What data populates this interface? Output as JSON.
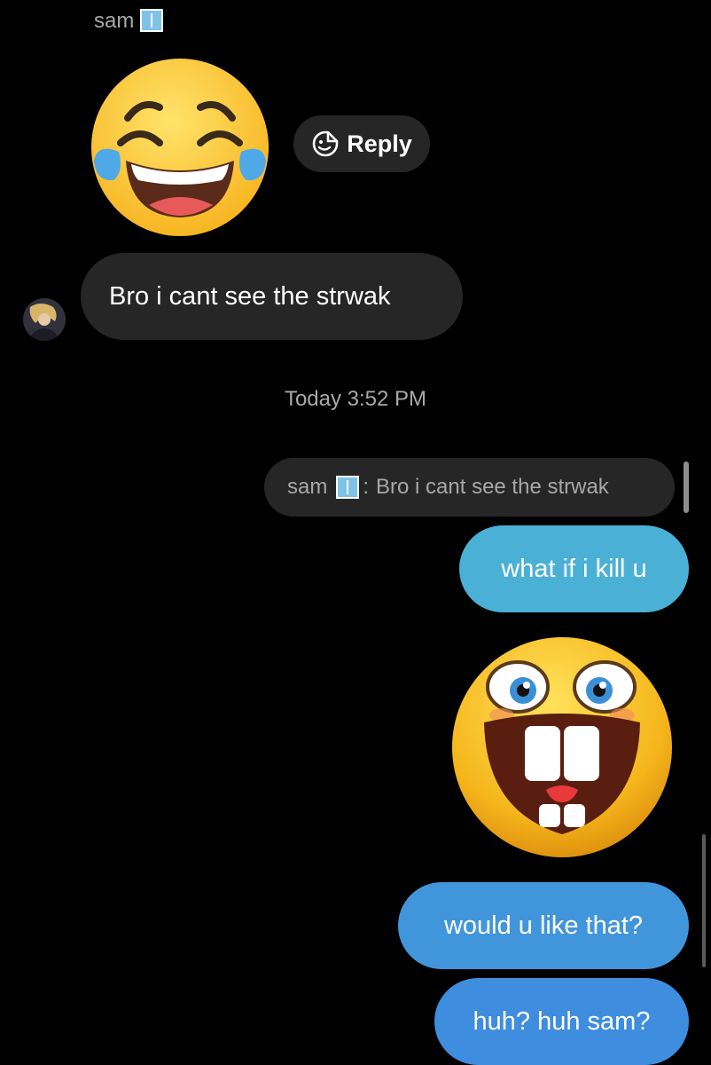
{
  "chat": {
    "sender_name": "sam",
    "reply_label": "Reply",
    "incoming_message": "Bro i cant see the strwak",
    "timestamp": "Today 3:52 PM",
    "quote": {
      "name": "sam",
      "separator": ":",
      "text": "Bro i cant see the strwak"
    },
    "outgoing_messages": [
      "what if i kill u",
      "would u like that?",
      "huh? huh sam?"
    ]
  },
  "icons": {
    "name_badge": "xray-emoji",
    "reply": "emoji-reply-icon",
    "sticker_incoming": "tears-of-joy-emoji",
    "sticker_outgoing": "laughing-buck-teeth-emoji"
  },
  "colors": {
    "background": "#000000",
    "incoming_bubble": "#262626",
    "outgoing_bubble_1": "#4ab0d6",
    "outgoing_bubble_2": "#4196db",
    "outgoing_bubble_3": "#3e8ddf",
    "muted_text": "#a8a8a8"
  }
}
